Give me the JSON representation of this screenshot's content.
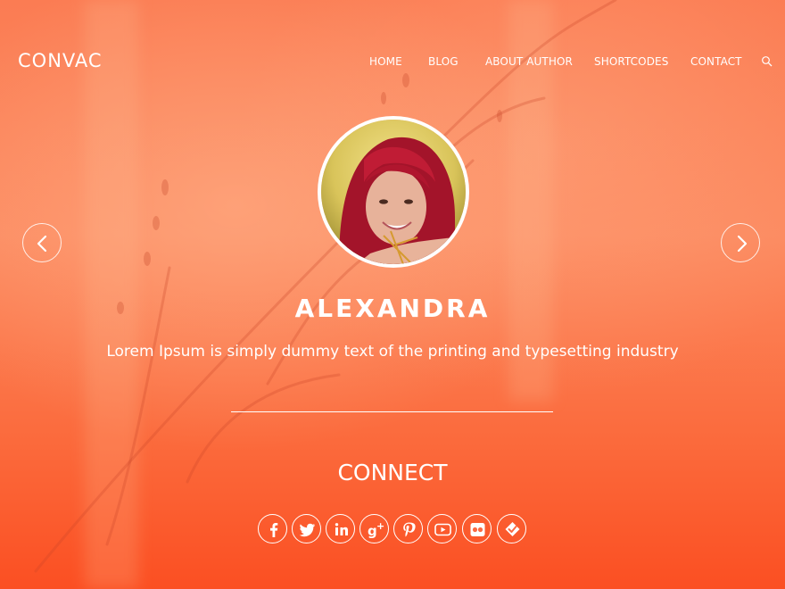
{
  "site": {
    "logo": "CONVAC"
  },
  "nav": {
    "items": [
      {
        "label": "HOME"
      },
      {
        "label": "BLOG"
      },
      {
        "label": "ABOUT AUTHOR"
      },
      {
        "label": "SHORTCODES"
      },
      {
        "label": "CONTACT"
      }
    ],
    "search_icon": "search-icon"
  },
  "hero": {
    "name": "ALEXANDRA",
    "tagline": "Lorem Ipsum is simply dummy text of the printing and typesetting industry",
    "prev_icon": "chevron-left-icon",
    "next_icon": "chevron-right-icon"
  },
  "connect": {
    "heading": "CONNECT",
    "social": [
      {
        "icon": "facebook-icon"
      },
      {
        "icon": "twitter-icon"
      },
      {
        "icon": "linkedin-icon"
      },
      {
        "icon": "google-plus-icon"
      },
      {
        "icon": "pinterest-icon"
      },
      {
        "icon": "youtube-icon"
      },
      {
        "icon": "flickr-icon"
      },
      {
        "icon": "foursquare-icon"
      }
    ]
  },
  "colors": {
    "accent": "#fb6a43",
    "text": "#ffffff"
  }
}
